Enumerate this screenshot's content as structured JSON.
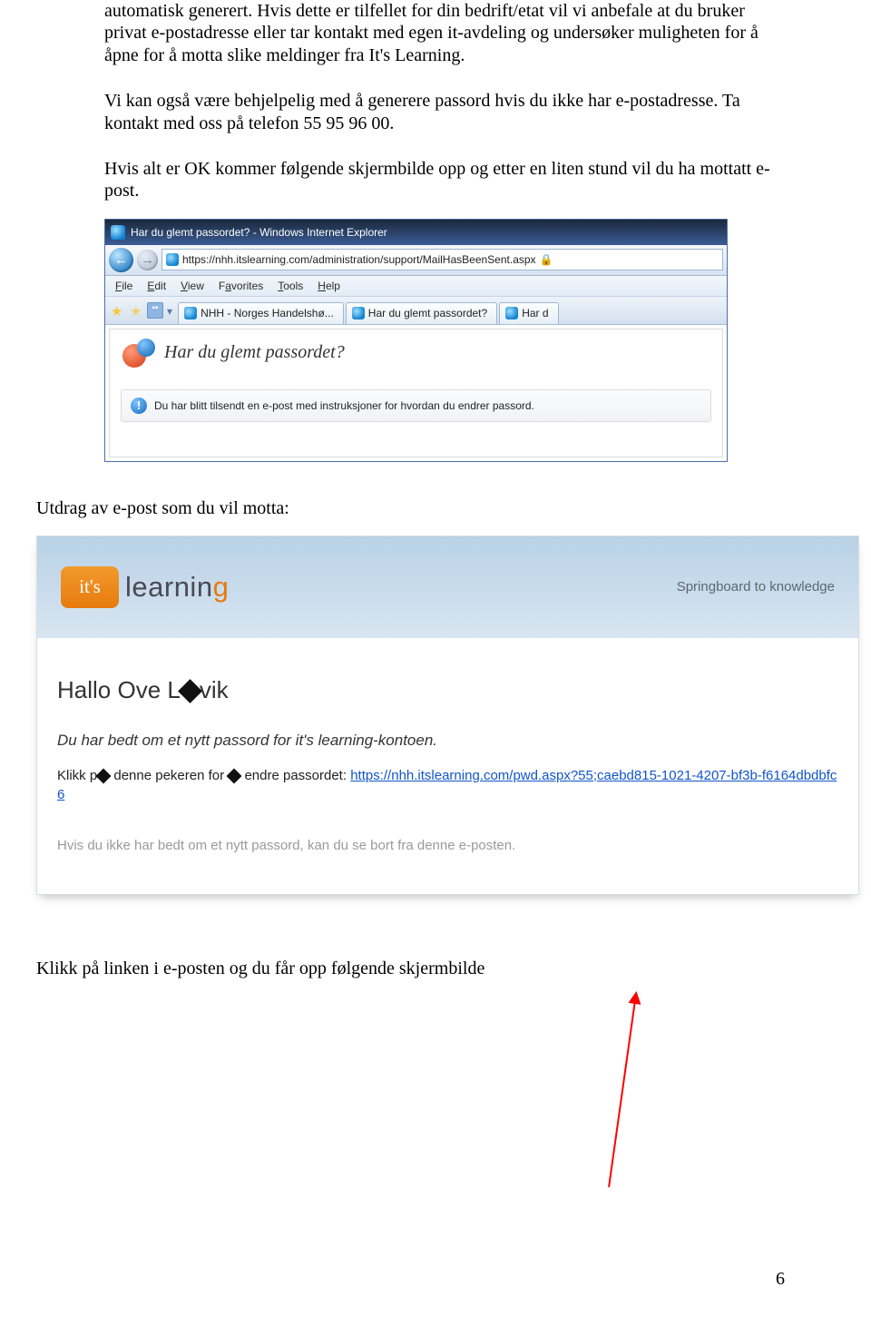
{
  "doc": {
    "p1": "automatisk generert. Hvis dette er tilfellet for din bedrift/etat vil vi anbefale at du bruker privat e-postadresse eller tar kontakt med egen it-avdeling og undersøker muligheten for å åpne for å motta slike meldinger fra It's Learning.",
    "p2": "Vi kan også være behjelpelig med å generere passord hvis du ikke har e-postadresse. Ta kontakt med oss på telefon 55 95 96 00.",
    "p3": "Hvis alt er OK kommer følgende skjermbilde opp og etter en liten stund vil du ha mottatt e-post.",
    "caption": "Utdrag av e-post som du vil motta:",
    "final": "Klikk på linken i e-posten og du får opp følgende skjermbilde",
    "pagenum": "6"
  },
  "ie": {
    "title": "Har du glemt passordet? - Windows Internet Explorer",
    "url": "https://nhh.itslearning.com/administration/support/MailHasBeenSent.aspx",
    "menu": {
      "file": "File",
      "edit": "Edit",
      "view": "View",
      "fav": "Favorites",
      "tools": "Tools",
      "help": "Help"
    },
    "tabs": {
      "a": "NHH - Norges Handelshø...",
      "b": "Har du glemt passordet?",
      "c": "Har d"
    },
    "pw_heading": "Har du glemt passordet?",
    "note": "Du har blitt tilsendt en e-post med instruksjoner for hvordan du endrer passord."
  },
  "email": {
    "logo_small": "it's",
    "logo_word_a": "learnin",
    "logo_word_b": "g",
    "tagline": "Springboard to knowledge",
    "greet_a": "Hallo Ove L",
    "greet_b": "vik",
    "request": "Du har bedt om et nytt passord for it's learning-kontoen.",
    "klikk_a": "Klikk p",
    "klikk_b": " denne pekeren for ",
    "klikk_c": " endre passordet: ",
    "link": "https://nhh.itslearning.com/pwd.aspx?55;caebd815-1021-4207-bf3b-f6164dbdbfc6",
    "ignore": "Hvis du ikke har bedt om et nytt passord, kan du se bort fra denne e-posten."
  }
}
